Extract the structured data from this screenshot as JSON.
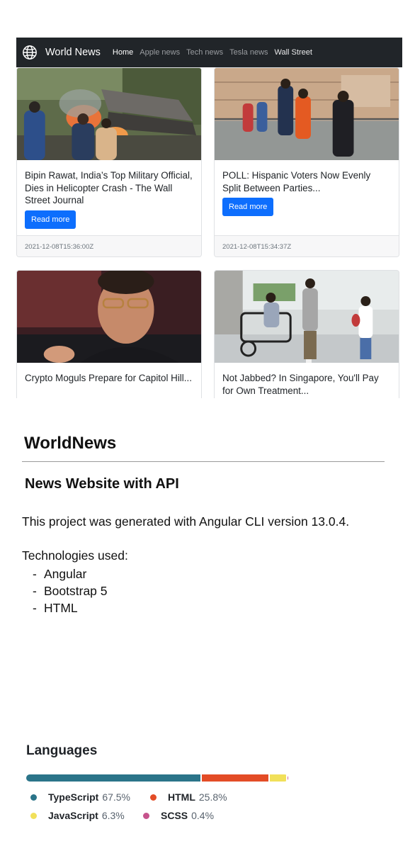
{
  "navbar": {
    "brand": "World News",
    "links": [
      {
        "label": "Home",
        "active": true
      },
      {
        "label": "Apple news"
      },
      {
        "label": "Tech news"
      },
      {
        "label": "Tesla news"
      },
      {
        "label": "Wall Street"
      }
    ]
  },
  "cards": [
    {
      "title": "Bipin Rawat, India’s Top Military Official, Dies in Helicopter Crash - The Wall Street Journal",
      "button": "Read more",
      "date": "2021-12-08T15:36:00Z",
      "image": "helicopter-crash-photo"
    },
    {
      "title": "POLL: Hispanic Voters Now Evenly Split Between Parties...",
      "button": "Read more",
      "date": "2021-12-08T15:34:37Z",
      "image": "voters-in-line-photo"
    },
    {
      "title": "Crypto Moguls Prepare for Capitol Hill...",
      "image": "speaker-with-headset-photo"
    },
    {
      "title": "Not Jabbed? In Singapore, You'll Pay for Own Treatment...",
      "image": "masked-people-hospital-photo"
    }
  ],
  "readme": {
    "title": "WorldNews",
    "subtitle": "News Website with API",
    "paragraph": "This project was generated with Angular CLI version 13.0.4.",
    "tech_heading": "Technologies used:",
    "technologies": [
      "Angular",
      "Bootstrap 5",
      "HTML"
    ]
  },
  "languages": {
    "title": "Languages",
    "items": [
      {
        "name": "TypeScript",
        "percent": "67.5%",
        "value": 67.5,
        "color": "#2b7489"
      },
      {
        "name": "HTML",
        "percent": "25.8%",
        "value": 25.8,
        "color": "#e34c26"
      },
      {
        "name": "JavaScript",
        "percent": "6.3%",
        "value": 6.3,
        "color": "#f1e05a"
      },
      {
        "name": "SCSS",
        "percent": "0.4%",
        "value": 0.4,
        "color": "#c6538c"
      }
    ]
  }
}
